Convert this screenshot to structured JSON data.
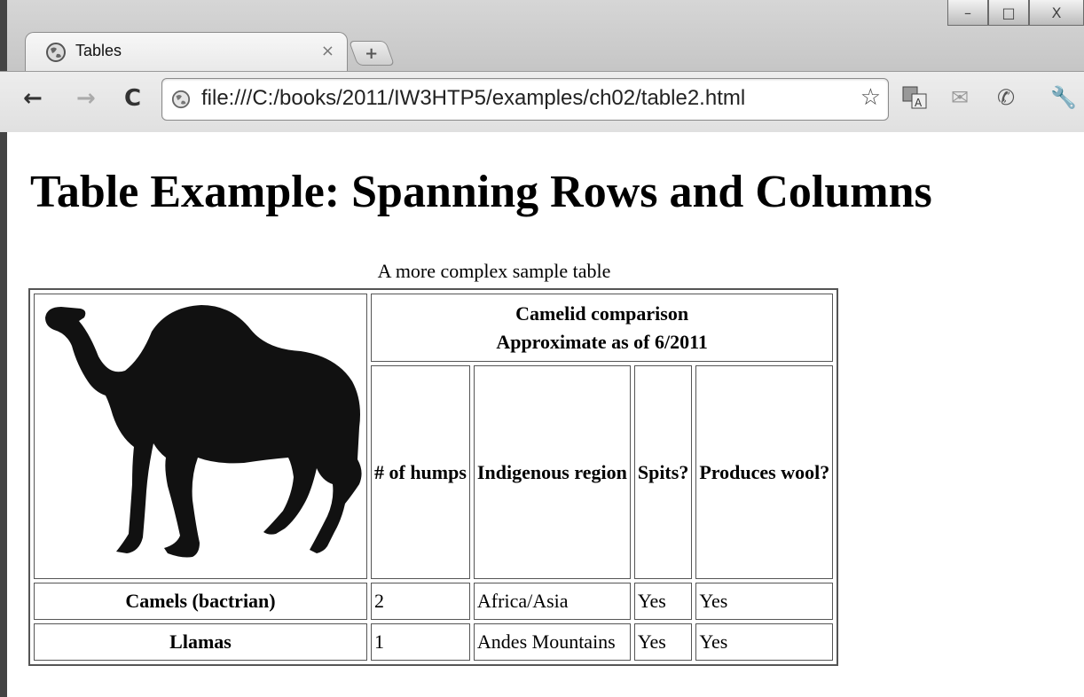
{
  "browser": {
    "tab_title": "Tables",
    "tab_close": "×",
    "new_tab": "+",
    "url": "file:///C:/books/2011/IW3HTP5/examples/ch02/table2.html",
    "nav": {
      "back": "←",
      "forward": "→",
      "reload": "C"
    },
    "window_controls": {
      "minimize": "–",
      "maximize": "□",
      "close": "X"
    },
    "toolbar_icons": [
      "translate-icon",
      "mail-icon",
      "phone-icon",
      "wrench-icon"
    ]
  },
  "page": {
    "heading": "Table Example: Spanning Rows and Columns",
    "caption": "A more complex sample table",
    "image_alt": "Picture of a one-hump camel",
    "header_main_line1": "Camelid comparison",
    "header_main_line2": "Approximate as of 6/2011",
    "columns": [
      "# of humps",
      "Indigenous region",
      "Spits?",
      "Produces wool?"
    ],
    "rows": [
      {
        "name": "Camels (bactrian)",
        "cells": [
          "2",
          "Africa/Asia",
          "Yes",
          "Yes"
        ]
      },
      {
        "name": "Llamas",
        "cells": [
          "1",
          "Andes Mountains",
          "Yes",
          "Yes"
        ]
      }
    ]
  }
}
